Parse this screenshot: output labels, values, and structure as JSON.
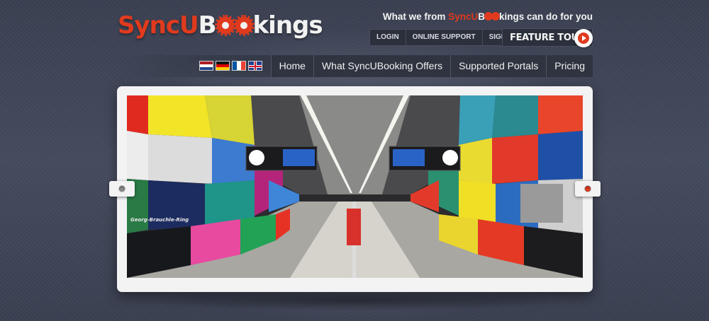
{
  "logo": {
    "part1": "SyncU",
    "part2_b": "B",
    "part2_rest": "kings",
    "alt": "SyncUBookings"
  },
  "tagline": {
    "before": "What we from ",
    "brand_red": "SyncU",
    "brand_b": "B",
    "brand_rest": "kings",
    "after": " can do for you"
  },
  "toplinks": [
    "LOGIN",
    "ONLINE SUPPORT",
    "SIGNUP"
  ],
  "feature_tour": {
    "label": "FEATURE TOUR"
  },
  "flags": [
    "netherlands-flag",
    "germany-flag",
    "france-flag",
    "uk-flag"
  ],
  "nav": [
    "Home",
    "What SyncUBooking Offers",
    "Supported Portals",
    "Pricing"
  ],
  "slider": {
    "station_sign": "Georg-Brauchle-Ring",
    "left_arrow": "slider-prev",
    "right_arrow": "slider-next"
  },
  "colors": {
    "brand_red": "#e03a1e",
    "background": "#3c4253",
    "nav_bg": "#2f3440"
  }
}
